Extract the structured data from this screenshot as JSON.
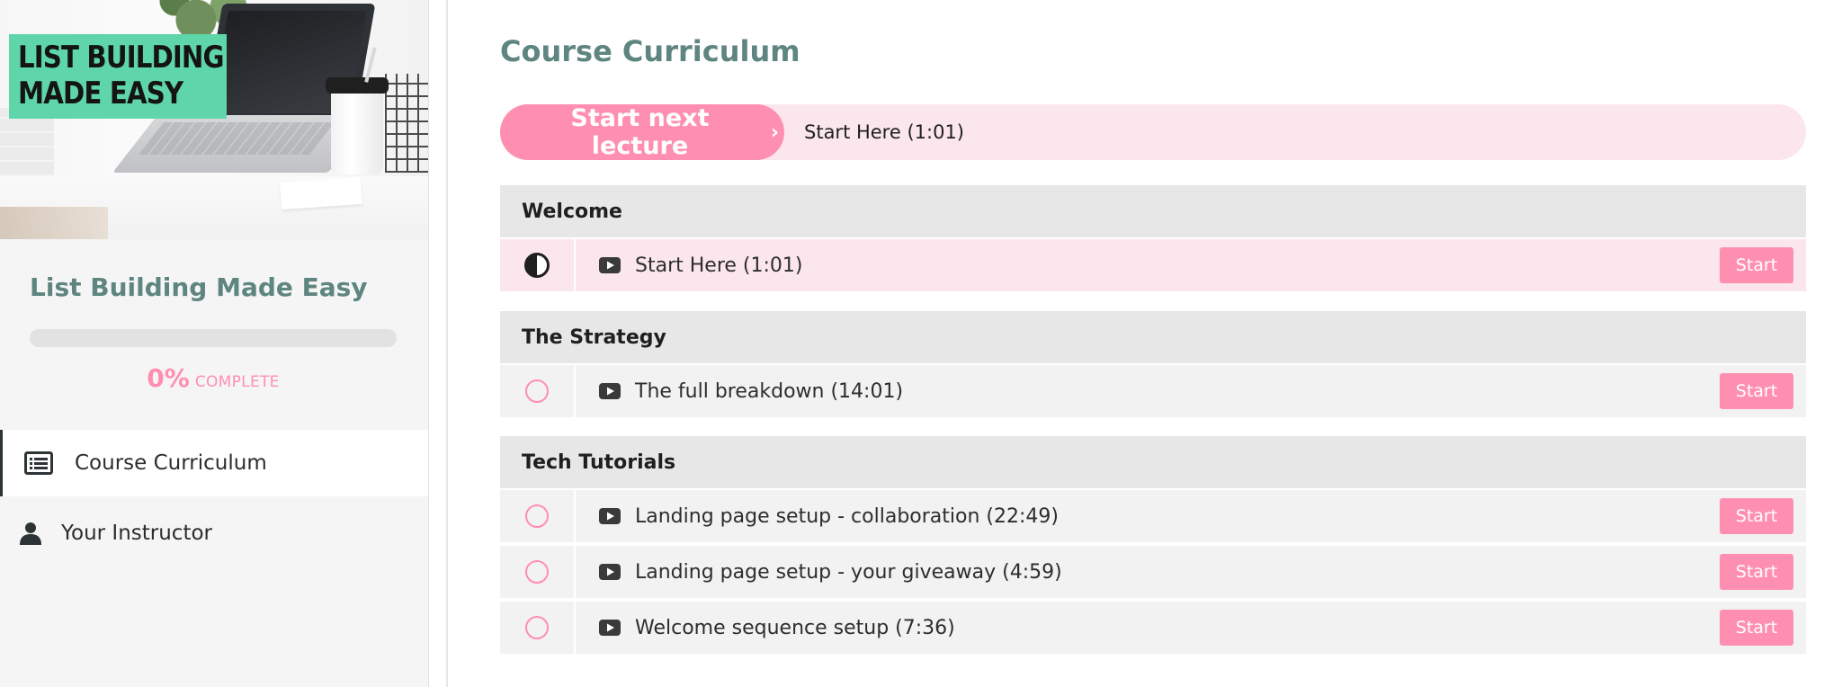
{
  "sidebar": {
    "course_image_text": {
      "line1": "LIST BUILDING",
      "line2": "MADE EASY"
    },
    "course_title": "List Building Made Easy",
    "progress": {
      "percent_value": 0,
      "percent_text": "0%",
      "label": "COMPLETE"
    },
    "nav": [
      {
        "label": "Course Curriculum",
        "icon": "list-icon",
        "active": true
      },
      {
        "label": "Your Instructor",
        "icon": "user-icon",
        "active": false
      }
    ]
  },
  "main": {
    "title": "Course Curriculum",
    "next_lecture": {
      "button_label": "Start next lecture",
      "chevron": "›",
      "lecture_title": "Start Here (1:01)"
    },
    "sections": [
      {
        "title": "Welcome",
        "lectures": [
          {
            "title": "Start Here (1:01)",
            "status": "in-progress",
            "action": "Start"
          }
        ]
      },
      {
        "title": "The Strategy",
        "lectures": [
          {
            "title": "The full breakdown (14:01)",
            "status": "not-started",
            "action": "Start"
          }
        ]
      },
      {
        "title": "Tech Tutorials",
        "lectures": [
          {
            "title": "Landing page setup - collaboration (22:49)",
            "status": "not-started",
            "action": "Start"
          },
          {
            "title": "Landing page setup - your giveaway (4:59)",
            "status": "not-started",
            "action": "Start"
          },
          {
            "title": "Welcome sequence setup (7:36)",
            "status": "not-started",
            "action": "Start"
          }
        ]
      }
    ]
  },
  "colors": {
    "accent_pink": "#ff8fb1",
    "light_pink": "#fbe6ed",
    "title_teal": "#5e8580",
    "badge_green": "#5ed6a9"
  }
}
